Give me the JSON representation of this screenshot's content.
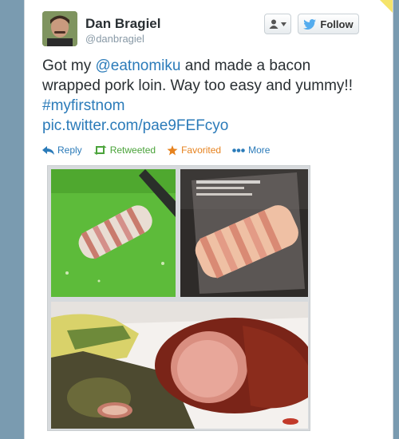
{
  "user": {
    "display_name": "Dan Bragiel",
    "handle": "@danbragiel"
  },
  "buttons": {
    "follow_label": "Follow"
  },
  "tweet": {
    "text_1": "Got my ",
    "mention": "@eatnomiku",
    "text_2": " and made a bacon wrapped pork loin.  Way too easy and yummy!! ",
    "hashtag": "#myfirstnom",
    "media_link": "pic.twitter.com/pae9FEFcyo"
  },
  "actions": {
    "reply": "Reply",
    "retweeted": "Retweeted",
    "favorited": "Favorited",
    "more": "More"
  },
  "colors": {
    "link": "#2b7bb9",
    "retweet": "#4aa33a",
    "favorite": "#e6821e"
  }
}
